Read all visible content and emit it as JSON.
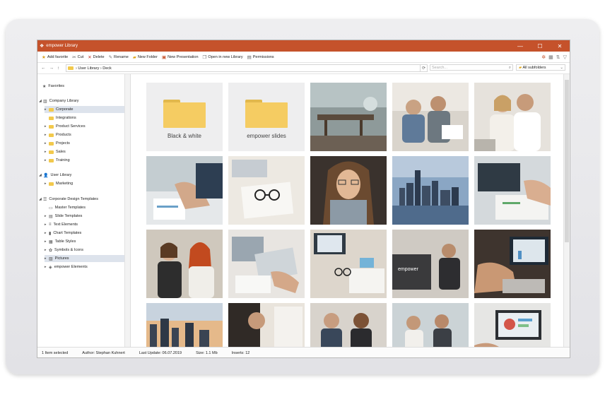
{
  "window": {
    "title": "empower Library"
  },
  "toolbar": {
    "buttons": [
      {
        "label": "Add favorite",
        "icon": "star-add-icon"
      },
      {
        "label": "Cut",
        "icon": "scissors-icon"
      },
      {
        "label": "Delete",
        "icon": "delete-icon"
      },
      {
        "label": "Rename",
        "icon": "rename-icon"
      },
      {
        "label": "New Folder",
        "icon": "new-folder-icon"
      },
      {
        "label": "New Presentation",
        "icon": "new-presentation-icon"
      },
      {
        "label": "Open in new Library",
        "icon": "open-library-icon"
      },
      {
        "label": "Permissions",
        "icon": "permissions-icon"
      }
    ]
  },
  "navbar": {
    "crumbs": [
      "User Library",
      "Deck"
    ],
    "search_placeholder": "Search...",
    "subfolders": "All subfolders"
  },
  "sidebar": {
    "favorites": "Favorites",
    "company_library": "Company Library",
    "company_items": [
      "Corporate",
      "Integrations",
      "Product Services",
      "Products",
      "Projects",
      "Sales",
      "Training"
    ],
    "user_library": "User Library",
    "user_items": [
      "Marketing"
    ],
    "cdt": "Corporate Design Templates",
    "cdt_items": [
      "Master Templates",
      "Slide Templates",
      "Text Elements",
      "Chart Templates",
      "Table Styles",
      "Symbols & Icons",
      "Pictures",
      "empower Elements"
    ]
  },
  "content": {
    "folders": [
      "Black & white",
      "empower slides"
    ]
  },
  "status": {
    "selected": "1 Item selected",
    "author": "Author: Stephan Kuhnert",
    "last_update": "Last Update: 06.07.2019",
    "size": "Size: 1.1 Mb",
    "inserts": "Inserts: 12"
  }
}
